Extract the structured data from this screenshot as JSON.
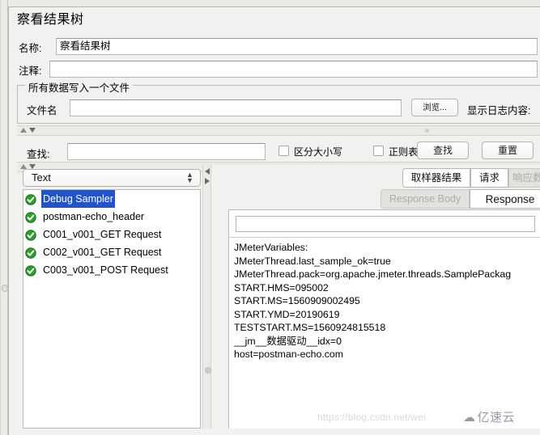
{
  "window": {
    "title": "察看结果树"
  },
  "form": {
    "name_label": "名称:",
    "name_value": "察看结果树",
    "comment_label": "注释:",
    "comment_value": ""
  },
  "file_group": {
    "legend": "所有数据写入一个文件",
    "filename_label": "文件名",
    "filename_value": "",
    "browse_button": "浏览...",
    "log_label": "显示日志内容:"
  },
  "search_bar": {
    "label": "查找:",
    "value": "",
    "case_sensitive_label": "区分大小写",
    "case_sensitive_checked": false,
    "regex_label": "正则表达式",
    "regex_checked": false,
    "find_button": "查找",
    "reset_button": "重置"
  },
  "renderer": {
    "selected": "Text"
  },
  "tree": {
    "items": [
      {
        "label": "Debug Sampler",
        "status": "success",
        "selected": true
      },
      {
        "label": "postman-echo_header",
        "status": "success",
        "selected": false
      },
      {
        "label": "C001_v001_GET Request",
        "status": "success",
        "selected": false
      },
      {
        "label": "C002_v001_GET Request",
        "status": "success",
        "selected": false
      },
      {
        "label": "C003_v001_POST Request",
        "status": "success",
        "selected": false
      }
    ]
  },
  "result_tabs": {
    "primary": [
      {
        "label": "取样器结果",
        "active": true
      },
      {
        "label": "请求",
        "active": true
      },
      {
        "label": "响应数据",
        "active": false
      }
    ],
    "secondary": [
      {
        "label": "Response Body",
        "active": false
      },
      {
        "label": "Response",
        "active": true
      }
    ]
  },
  "response": {
    "search_value": "",
    "body": "JMeterVariables:\nJMeterThread.last_sample_ok=true\nJMeterThread.pack=org.apache.jmeter.threads.SamplePackag\nSTART.HMS=095002\nSTART.MS=1560909002495\nSTART.YMD=20190619\nTESTSTART.MS=1560924815518\n__jm__数据驱动__idx=0\nhost=postman-echo.com"
  },
  "watermark": {
    "url": "https://blog.csdn.net/wei",
    "brand": "亿速云"
  },
  "colors": {
    "selection_blue": "#2154c9",
    "status_green": "#2f9e2f",
    "panel_bg": "#f2f1ef"
  }
}
